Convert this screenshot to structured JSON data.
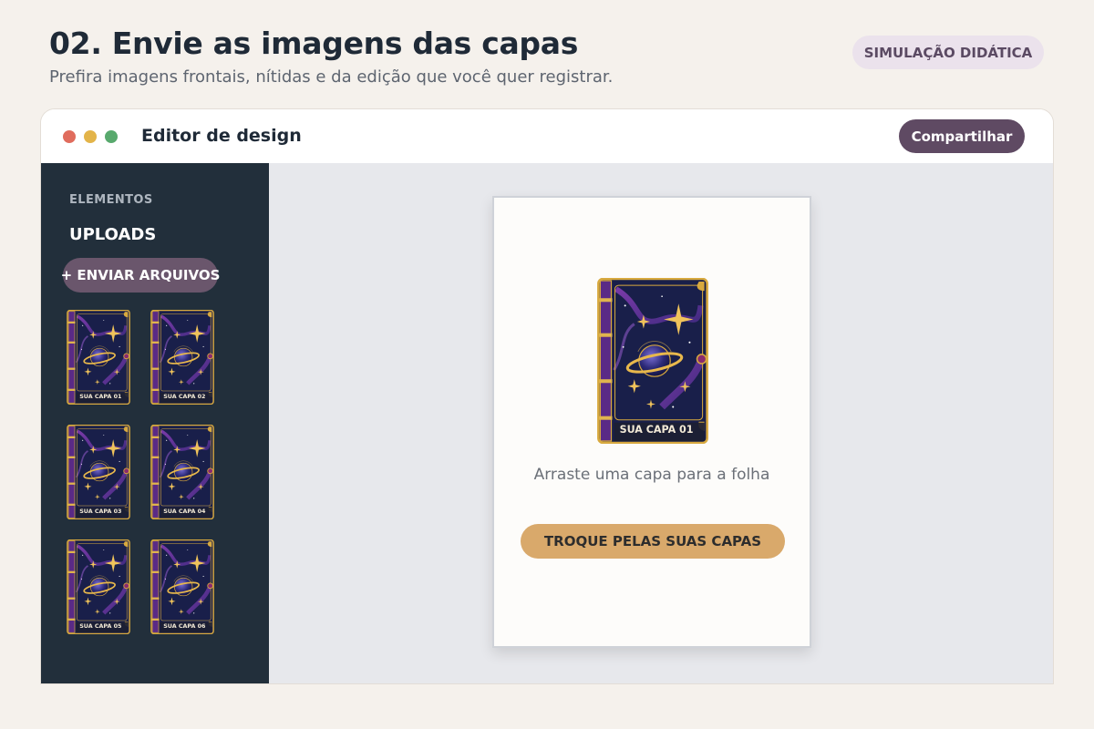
{
  "page": {
    "title": "02. Envie as imagens das capas",
    "subtitle": "Prefira imagens frontais, nítidas e da edição que você quer registrar.",
    "badge": "SIMULAÇÃO DIDÁTICA"
  },
  "window": {
    "title": "Editor de design",
    "share_label": "Compartilhar"
  },
  "sidebar": {
    "section_label": "ELEMENTOS",
    "heading": "UPLOADS",
    "upload_label": "+ ENVIAR ARQUIVOS",
    "covers": [
      {
        "label": "SUA CAPA 01"
      },
      {
        "label": "SUA CAPA 02"
      },
      {
        "label": "SUA CAPA 03"
      },
      {
        "label": "SUA CAPA 04"
      },
      {
        "label": "SUA CAPA 05"
      },
      {
        "label": "SUA CAPA 06"
      }
    ]
  },
  "canvas": {
    "placed_cover_label": "SUA CAPA 01",
    "drag_hint": "Arraste uma capa para a folha",
    "swap_label": "TROQUE PELAS SUAS CAPAS"
  },
  "colors": {
    "background": "#f5f1ec",
    "sidebar": "#222f3b",
    "accent_purple": "#5f4a63",
    "accent_gold": "#d9a96b",
    "book_navy": "#191f4a",
    "book_gold": "#d8a93f"
  }
}
